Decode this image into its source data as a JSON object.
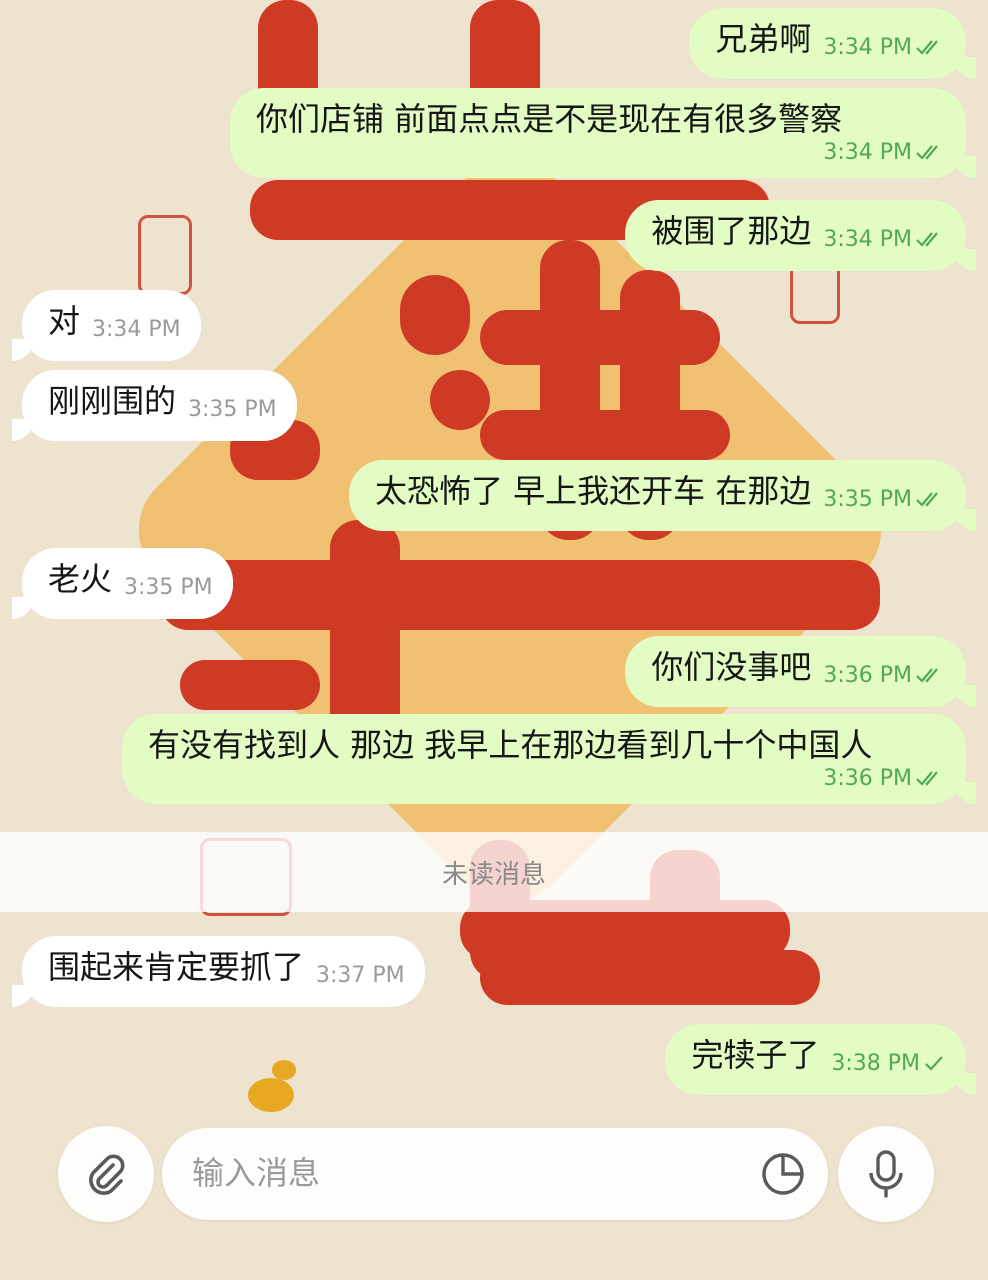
{
  "colors": {
    "outgoing_bubble": "#e2fcc3",
    "incoming_bubble": "#ffffff",
    "read_check": "#53a852",
    "meta_incoming": "#9a9a9a"
  },
  "messages": [
    {
      "direction": "out",
      "text": "兄弟啊",
      "time": "3:34 PM",
      "status": "read"
    },
    {
      "direction": "out",
      "text": "你们店铺 前面点点是不是现在有很多警察",
      "time": "3:34 PM",
      "status": "read"
    },
    {
      "direction": "out",
      "text": "被围了那边",
      "time": "3:34 PM",
      "status": "read"
    },
    {
      "direction": "in",
      "text": "对",
      "time": "3:34 PM"
    },
    {
      "direction": "in",
      "text": "刚刚围的",
      "time": "3:35 PM"
    },
    {
      "direction": "out",
      "text": "太恐怖了  早上我还开车  在那边",
      "time": "3:35 PM",
      "status": "read"
    },
    {
      "direction": "in",
      "text": "老火",
      "time": "3:35 PM"
    },
    {
      "direction": "out",
      "text": "你们没事吧",
      "time": "3:36 PM",
      "status": "read"
    },
    {
      "direction": "out",
      "text": "有没有找到人  那边  我早上在那边看到几十个中国人",
      "time": "3:36 PM",
      "status": "read"
    },
    {
      "direction": "in",
      "text": "围起来肯定要抓了",
      "time": "3:37 PM"
    },
    {
      "direction": "out",
      "text": "完犊子了",
      "time": "3:38 PM",
      "status": "sent"
    }
  ],
  "unread_divider": "未读消息",
  "composer": {
    "placeholder": "输入消息",
    "attach_icon": "paperclip-icon",
    "sticker_icon": "sticker-icon",
    "voice_icon": "microphone-icon"
  }
}
